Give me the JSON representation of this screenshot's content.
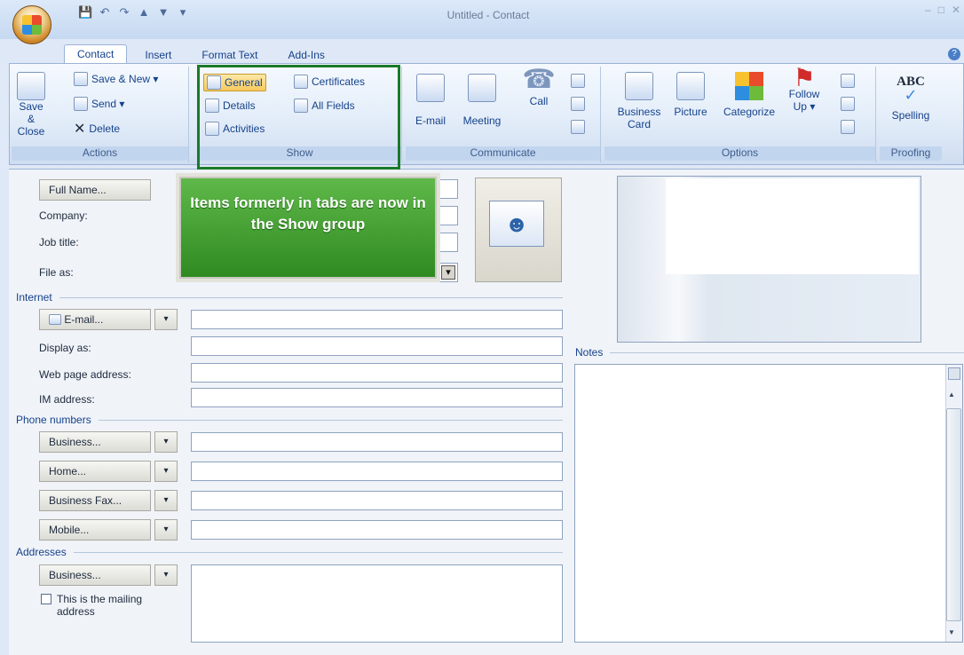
{
  "window": {
    "title": "Untitled - Contact",
    "controls": [
      "–",
      "□",
      "✕"
    ]
  },
  "qat": [
    "💾",
    "↶",
    "↷",
    "▲",
    "▼",
    "▾"
  ],
  "tabs": [
    "Contact",
    "Insert",
    "Format Text",
    "Add-Ins"
  ],
  "ribbon": {
    "actions": {
      "label": "Actions",
      "save_close": "Save & Close",
      "save_new": "Save & New ▾",
      "send": "Send ▾",
      "delete": "Delete"
    },
    "show": {
      "label": "Show",
      "general": "General",
      "certificates": "Certificates",
      "details": "Details",
      "all_fields": "All Fields",
      "activities": "Activities"
    },
    "communicate": {
      "label": "Communicate",
      "email": "E-mail",
      "meeting": "Meeting",
      "call": "Call"
    },
    "options": {
      "label": "Options",
      "business_card": "Business Card",
      "picture": "Picture",
      "categorize": "Categorize",
      "follow_up": "Follow Up ▾"
    },
    "proofing": {
      "label": "Proofing",
      "spelling": "Spelling",
      "abc": "ABC"
    }
  },
  "form": {
    "full_name_button": "Full Name...",
    "company_label": "Company:",
    "job_title_label": "Job title:",
    "file_as_label": "File as:",
    "callout": "Items formerly in tabs are now in the Show group",
    "internet_section": "Internet",
    "email_button": "E-mail...",
    "display_as_label": "Display as:",
    "web_page_label": "Web page address:",
    "im_label": "IM address:",
    "phone_section": "Phone numbers",
    "phones": [
      "Business...",
      "Home...",
      "Business Fax...",
      "Mobile..."
    ],
    "addresses_section": "Addresses",
    "address_button": "Business...",
    "mailing_label": "This is the mailing address",
    "notes_label": "Notes",
    "dropdown_arrow": "▾"
  }
}
